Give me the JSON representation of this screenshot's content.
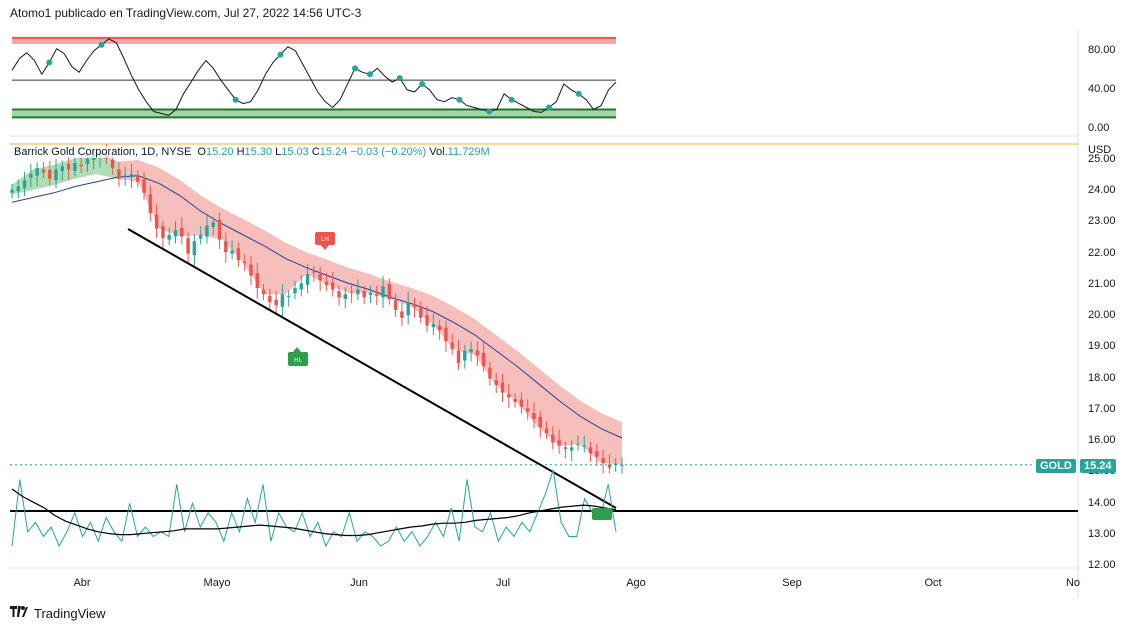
{
  "header": {
    "text": "Atomo1 publicado en TradingView.com, Jul 27, 2022 14:56 UTC-3"
  },
  "footer": {
    "brand": "TradingView"
  },
  "legend": {
    "symbol": "Barrick Gold Corporation, 1D, NYSE",
    "o_label": "O",
    "o": "15.20",
    "h_label": "H",
    "h": "15.30",
    "l_label": "L",
    "l": "15.03",
    "c_label": "C",
    "c": "15.24",
    "change": "−0.03 (−0.20%)",
    "vol_label": "Vol.",
    "vol": "11.729M"
  },
  "price_badge": {
    "ticker": "GOLD",
    "price": "15.24"
  },
  "colors": {
    "up": "#26a69a",
    "down": "#ef5350",
    "cloud_down": "#f4b4b0",
    "cloud_up": "#a5d6a7",
    "ma": "#2a3f99",
    "axis_text": "#131722",
    "grid_hline": "#f5b041"
  },
  "chart_data": [
    {
      "type": "line",
      "name": "oscillator",
      "yticks": [
        "80.00",
        "40.00",
        "0.00"
      ],
      "ylim": [
        -5,
        95
      ],
      "bands": {
        "overbought": 90,
        "oversold_top": 20,
        "oversold_bottom": 12,
        "mid": 50
      },
      "values": [
        60,
        72,
        78,
        70,
        56,
        68,
        82,
        77,
        64,
        58,
        70,
        80,
        86,
        92,
        88,
        72,
        55,
        40,
        28,
        18,
        16,
        14,
        20,
        36,
        48,
        60,
        70,
        62,
        50,
        40,
        30,
        26,
        28,
        40,
        56,
        68,
        76,
        84,
        80,
        66,
        52,
        38,
        28,
        22,
        30,
        46,
        62,
        58,
        56,
        62,
        54,
        48,
        52,
        40,
        38,
        46,
        40,
        30,
        28,
        32,
        30,
        24,
        22,
        20,
        18,
        20,
        36,
        30,
        26,
        22,
        18,
        17,
        22,
        28,
        46,
        40,
        36,
        30,
        20,
        24,
        40,
        48
      ],
      "dots": [
        5,
        12,
        30,
        36,
        46,
        48,
        52,
        55,
        60,
        64,
        67,
        72,
        76
      ]
    },
    {
      "type": "candlestick",
      "name": "GOLD",
      "ylabel": "USD",
      "ylim": [
        12.0,
        25.0
      ],
      "yticks": [
        "25.00",
        "24.00",
        "23.00",
        "22.00",
        "21.00",
        "20.00",
        "19.00",
        "18.00",
        "17.00",
        "16.00",
        "15.00",
        "14.00",
        "13.00",
        "12.00"
      ],
      "x_labels": [
        "Abr",
        "Mayo",
        "Jun",
        "Jul",
        "Ago",
        "Sep",
        "Oct",
        "No"
      ],
      "closes": [
        24.05,
        24.15,
        24.35,
        24.55,
        24.75,
        24.6,
        24.4,
        24.7,
        24.8,
        24.7,
        24.9,
        24.8,
        25.05,
        25.15,
        25.1,
        25.05,
        24.75,
        24.4,
        24.5,
        24.55,
        24.3,
        23.95,
        23.3,
        22.8,
        22.5,
        22.6,
        22.75,
        22.55,
        22.0,
        22.4,
        22.6,
        22.9,
        23.0,
        22.45,
        22.05,
        22.1,
        21.8,
        21.7,
        21.3,
        20.9,
        20.7,
        20.45,
        20.35,
        20.7,
        20.65,
        20.9,
        21.05,
        21.35,
        21.4,
        21.15,
        21.0,
        20.85,
        20.6,
        20.7,
        20.75,
        20.85,
        20.6,
        20.75,
        20.65,
        20.95,
        20.55,
        20.2,
        19.95,
        20.45,
        20.3,
        19.95,
        19.7,
        19.75,
        19.55,
        19.2,
        18.95,
        18.5,
        18.9,
        18.95,
        18.75,
        18.4,
        18.0,
        17.8,
        17.55,
        17.4,
        17.25,
        17.1,
        16.95,
        16.7,
        16.45,
        16.25,
        15.95,
        15.85,
        15.75,
        15.8,
        15.9,
        15.85,
        15.6,
        15.5,
        15.3,
        15.15,
        15.27,
        15.24
      ],
      "moving_average": [
        24.0,
        24.15,
        24.3,
        24.5,
        24.65,
        24.8,
        24.85,
        24.6,
        24.2,
        23.7,
        23.3,
        22.95,
        22.6,
        22.2,
        21.9,
        21.65,
        21.4,
        21.2,
        20.95,
        20.75,
        20.5,
        20.15,
        19.75,
        19.25,
        18.75,
        18.2,
        17.65,
        17.15,
        16.75,
        16.45
      ],
      "annotations": [
        {
          "text": "LH"
        },
        {
          "text": "HL"
        }
      ],
      "last_price": 15.24
    },
    {
      "type": "line",
      "name": "volume-oscillator",
      "values": [
        0.2,
        0.9,
        0.35,
        0.45,
        0.3,
        0.4,
        0.2,
        0.35,
        0.55,
        0.3,
        0.45,
        0.25,
        0.5,
        0.35,
        0.25,
        0.65,
        0.3,
        0.4,
        0.3,
        0.35,
        0.3,
        0.85,
        0.35,
        0.65,
        0.4,
        0.55,
        0.45,
        0.25,
        0.55,
        0.35,
        0.7,
        0.45,
        0.85,
        0.25,
        0.55,
        0.4,
        0.35,
        0.55,
        0.3,
        0.45,
        0.2,
        0.35,
        0.3,
        0.55,
        0.25,
        0.35,
        0.3,
        0.2,
        0.25,
        0.4,
        0.25,
        0.35,
        0.2,
        0.3,
        0.45,
        0.3,
        0.6,
        0.25,
        0.9,
        0.4,
        0.35,
        0.55,
        0.25,
        0.4,
        0.3,
        0.45,
        0.35,
        0.55,
        0.75,
        1.0,
        0.45,
        0.3,
        0.3,
        0.7,
        0.55,
        0.5,
        0.85,
        0.35
      ],
      "baseline": [
        0.8,
        0.72,
        0.66,
        0.6,
        0.52,
        0.46,
        0.42,
        0.38,
        0.35,
        0.33,
        0.32,
        0.32,
        0.33,
        0.34,
        0.35,
        0.36,
        0.38,
        0.38,
        0.38,
        0.38,
        0.39,
        0.4,
        0.41,
        0.42,
        0.41,
        0.4,
        0.39,
        0.37,
        0.35,
        0.33,
        0.32,
        0.31,
        0.31,
        0.32,
        0.34,
        0.36,
        0.38,
        0.4,
        0.41,
        0.43,
        0.44,
        0.44,
        0.45,
        0.47,
        0.48,
        0.49,
        0.5,
        0.52,
        0.55,
        0.57,
        0.59,
        0.61,
        0.62,
        0.63,
        0.62,
        0.6,
        0.58
      ]
    }
  ]
}
